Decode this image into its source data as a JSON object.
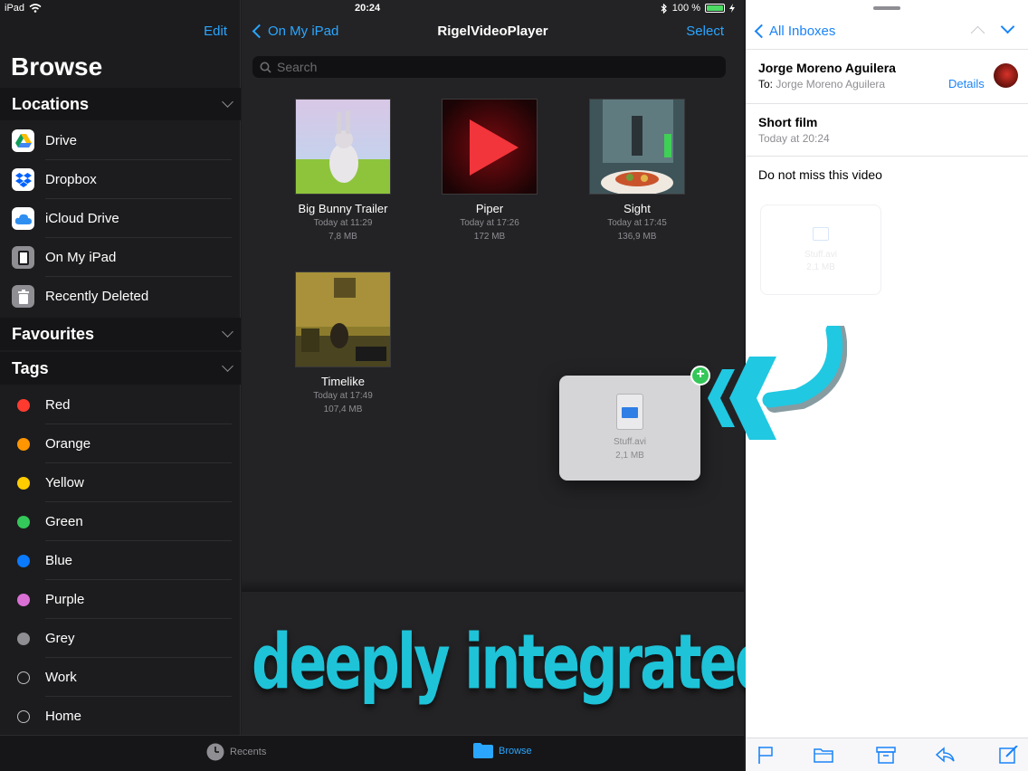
{
  "status": {
    "device": "iPad",
    "time": "20:24",
    "battery": "100 %"
  },
  "sidebar": {
    "edit_label": "Edit",
    "title": "Browse",
    "sections": {
      "locations": "Locations",
      "favourites": "Favourites",
      "tags": "Tags"
    },
    "locations": [
      {
        "label": "Drive",
        "icon": "google-drive-icon"
      },
      {
        "label": "Dropbox",
        "icon": "dropbox-icon"
      },
      {
        "label": "iCloud Drive",
        "icon": "icloud-icon"
      },
      {
        "label": "On My iPad",
        "icon": "ipad-icon"
      },
      {
        "label": "Recently Deleted",
        "icon": "trash-icon"
      }
    ],
    "tags": [
      {
        "label": "Red",
        "color": "#ff3b30"
      },
      {
        "label": "Orange",
        "color": "#ff9500"
      },
      {
        "label": "Yellow",
        "color": "#ffcc00"
      },
      {
        "label": "Green",
        "color": "#34c759"
      },
      {
        "label": "Blue",
        "color": "#0a7aff"
      },
      {
        "label": "Purple",
        "color": "#da70d6"
      },
      {
        "label": "Grey",
        "color": "#8e8e93"
      },
      {
        "label": "Work",
        "color": ""
      },
      {
        "label": "Home",
        "color": ""
      }
    ]
  },
  "browser": {
    "back_label": "On My iPad",
    "title": "RigelVideoPlayer",
    "select_label": "Select",
    "search_placeholder": "Search",
    "files": [
      {
        "name": "Big Bunny Trailer",
        "date": "Today at 11:29",
        "size": "7,8 MB"
      },
      {
        "name": "Piper",
        "date": "Today at 17:26",
        "size": "172 MB"
      },
      {
        "name": "Sight",
        "date": "Today at 17:45",
        "size": "136,9 MB"
      },
      {
        "name": "Timelike",
        "date": "Today at 17:49",
        "size": "107,4 MB"
      }
    ],
    "drag_item": {
      "name": "Stuff.avi",
      "size": "2,1 MB",
      "badge": "+"
    }
  },
  "tabbar": {
    "recents": "Recents",
    "browse": "Browse"
  },
  "overlay": {
    "slogan": "deeply integrated"
  },
  "mail": {
    "back_label": "All Inboxes",
    "sender": "Jorge Moreno Aguilera",
    "to_label": "To:",
    "to_value": "Jorge Moreno Aguilera",
    "details_label": "Details",
    "subject": "Short film",
    "date": "Today at 20:24",
    "body": "Do not miss this video",
    "attachment": {
      "name": "Stuff.avi",
      "size": "2,1 MB"
    },
    "toolbar": [
      "flag-icon",
      "folder-icon",
      "archive-icon",
      "reply-icon",
      "compose-icon"
    ]
  },
  "colors": {
    "accent": "#2aa6ff",
    "mail_accent": "#1a84f7",
    "slogan": "#1ec3d8"
  }
}
